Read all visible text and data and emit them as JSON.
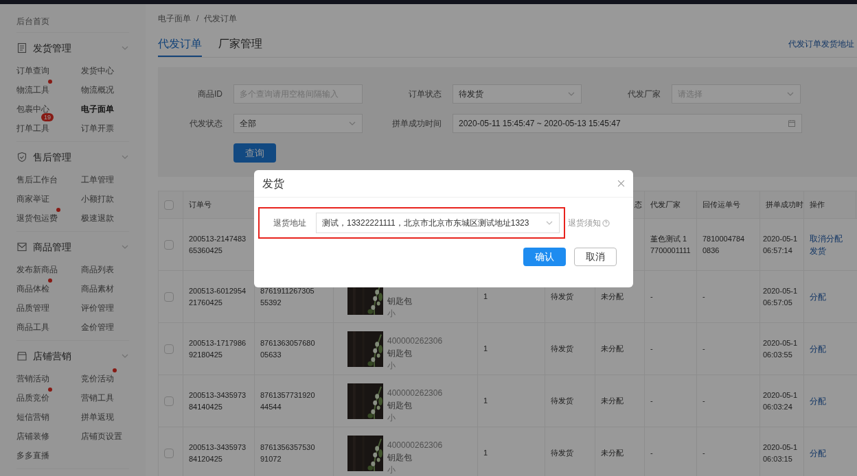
{
  "sidebar": {
    "home": "后台首页",
    "sections": [
      {
        "title": "发货管理",
        "items": [
          {
            "label": "订单查询",
            "selected": false,
            "dot": false
          },
          {
            "label": "发货中心",
            "selected": false,
            "dot": false
          },
          {
            "label": "物流工具",
            "selected": false,
            "dot": true
          },
          {
            "label": "物流概况",
            "selected": false,
            "dot": false
          },
          {
            "label": "包裹中心",
            "selected": false,
            "dot": false
          },
          {
            "label": "电子面单",
            "selected": true,
            "dot": false
          },
          {
            "label": "打单工具",
            "selected": false,
            "dot": false,
            "badge": "19"
          },
          {
            "label": "订单开票",
            "selected": false,
            "dot": false
          }
        ]
      },
      {
        "title": "售后管理",
        "items": [
          {
            "label": "售后工作台",
            "selected": false,
            "dot": false
          },
          {
            "label": "工单管理",
            "selected": false,
            "dot": false
          },
          {
            "label": "商家举证",
            "selected": false,
            "dot": false
          },
          {
            "label": "小额打款",
            "selected": false,
            "dot": false
          },
          {
            "label": "退货包运费",
            "selected": false,
            "dot": true
          },
          {
            "label": "极速退款",
            "selected": false,
            "dot": false
          }
        ]
      },
      {
        "title": "商品管理",
        "items": [
          {
            "label": "发布新商品",
            "selected": false,
            "dot": false
          },
          {
            "label": "商品列表",
            "selected": false,
            "dot": false
          },
          {
            "label": "商品体检",
            "selected": false,
            "dot": true
          },
          {
            "label": "商品素材",
            "selected": false,
            "dot": false
          },
          {
            "label": "品质管理",
            "selected": false,
            "dot": false
          },
          {
            "label": "评价管理",
            "selected": false,
            "dot": false
          },
          {
            "label": "商品工具",
            "selected": false,
            "dot": false
          },
          {
            "label": "金价管理",
            "selected": false,
            "dot": false
          }
        ]
      },
      {
        "title": "店铺营销",
        "items": [
          {
            "label": "营销活动",
            "selected": false,
            "dot": false
          },
          {
            "label": "竞价活动",
            "selected": false,
            "dot": true
          },
          {
            "label": "品质竞价",
            "selected": false,
            "dot": true
          },
          {
            "label": "营销工具",
            "selected": false,
            "dot": false
          },
          {
            "label": "短信营销",
            "selected": false,
            "dot": false
          },
          {
            "label": "拼单返现",
            "selected": false,
            "dot": false
          },
          {
            "label": "店铺装修",
            "selected": false,
            "dot": false
          },
          {
            "label": "店铺页设置",
            "selected": false,
            "dot": false
          },
          {
            "label": "多多直播",
            "selected": false,
            "dot": false
          }
        ]
      }
    ]
  },
  "breadcrumb": [
    "电子面单",
    "/",
    "代发订单"
  ],
  "tabs": [
    {
      "label": "代发订单",
      "selected": true
    },
    {
      "label": "厂家管理",
      "selected": false
    }
  ],
  "top_link": "代发订单发货地址",
  "filters": [
    {
      "label": "商品ID",
      "kind": "input",
      "placeholder": "多个查询请用空格间隔输入"
    },
    {
      "label": "订单状态",
      "kind": "select",
      "value": "待发货"
    },
    {
      "label": "代发厂家",
      "kind": "select",
      "placeholder": "请选择"
    },
    {
      "label": "代发状态",
      "kind": "select",
      "value": "全部"
    },
    {
      "label": "拼单成功时间",
      "kind": "daterange",
      "value": "2020-05-11 15:45:47 ~ 2020-05-13 15:45:47"
    }
  ],
  "search_button": "查询",
  "table": {
    "select_all_checked": false,
    "columns": [
      "订单号",
      "",
      "",
      "",
      "",
      "态",
      "代发厂家",
      "回传运单号",
      "拼单成功时",
      "操作"
    ],
    "rows": [
      {
        "checked": false,
        "order": "200513-2147483 65360425",
        "waybill": "",
        "product": null,
        "qty": "",
        "status": "",
        "assign": "",
        "factory": "堇色测试 17700001111",
        "return_no": "7810004784 0836",
        "time": [
          "2020-05-1",
          "06:57:14"
        ],
        "actions": [
          "取消分配",
          "发货"
        ]
      },
      {
        "checked": false,
        "order": "200513-6012954 21760425",
        "waybill": "8761911267305 55392",
        "product": {
          "name": "钥匙包",
          "spec": "小"
        },
        "qty": "1",
        "status": "待发货",
        "assign": "未分配",
        "factory": "-",
        "return_no": "-",
        "time": [
          "2020-05-1",
          "06:57:05"
        ],
        "actions": [
          "分配"
        ]
      },
      {
        "checked": false,
        "order": "200513-1717986 92180425",
        "waybill": "8761363057680 05633",
        "product": {
          "id": "400000262306",
          "name": "钥匙包",
          "spec": "小"
        },
        "qty": "1",
        "status": "待发货",
        "assign": "未分配",
        "factory": "-",
        "return_no": "-",
        "time": [
          "2020-05-1",
          "06:03:55"
        ],
        "actions": [
          "分配"
        ]
      },
      {
        "checked": false,
        "order": "200513-3435973 84140425",
        "waybill": "8761357731920 44544",
        "product": {
          "id": "400000262306",
          "name": "钥匙包",
          "spec": "小"
        },
        "qty": "1",
        "status": "待发货",
        "assign": "未分配",
        "factory": "-",
        "return_no": "-",
        "time": [
          "2020-05-1",
          "06:03:24"
        ],
        "actions": [
          "分配"
        ]
      },
      {
        "checked": false,
        "order": "200513-3435973 84120425",
        "waybill": "8761356357530 91072",
        "product": {
          "id": "400000262306",
          "name": "钥匙包",
          "spec": "小"
        },
        "qty": "1",
        "status": "待发货",
        "assign": "未分配",
        "factory": "-",
        "return_no": "-",
        "time": [
          "2020-05-1",
          "06:03:15"
        ],
        "actions": [
          "分配"
        ]
      }
    ]
  },
  "modal": {
    "title": "发货",
    "field_label": "退货地址",
    "field_value": "测试，13322221111，北京市北京市东城区测试地址1323",
    "highlighted": true,
    "help_link": "退货须知",
    "buttons": [
      {
        "label": "确认",
        "kind": "primary"
      },
      {
        "label": "取消",
        "kind": "default"
      }
    ]
  }
}
